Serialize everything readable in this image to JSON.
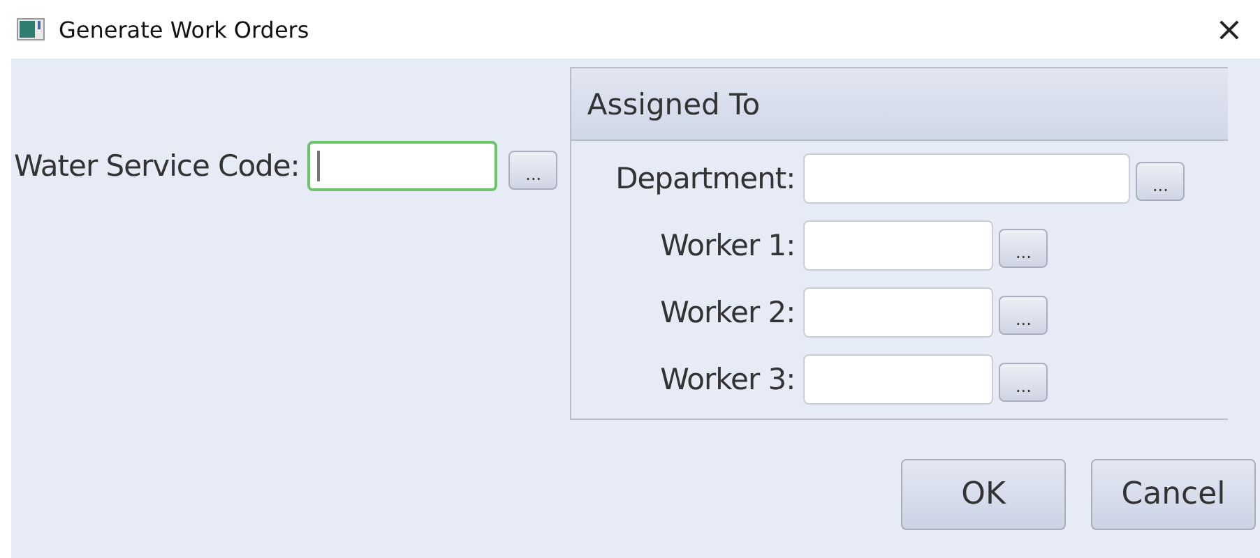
{
  "window": {
    "title": "Generate Work Orders",
    "close": "×"
  },
  "water_service_code": {
    "label": "Water Service Code:",
    "focused": true,
    "browse": "..."
  },
  "assigned_to": {
    "title": "Assigned To",
    "fields": [
      {
        "label": "Department:",
        "kind": "wide",
        "browse": "..."
      },
      {
        "label": "Worker 1:",
        "kind": "narrow",
        "browse": "..."
      },
      {
        "label": "Worker 2:",
        "kind": "narrow",
        "browse": "..."
      },
      {
        "label": "Worker 3:",
        "kind": "narrow",
        "browse": "..."
      }
    ]
  },
  "buttons": [
    "OK",
    "Cancel"
  ]
}
